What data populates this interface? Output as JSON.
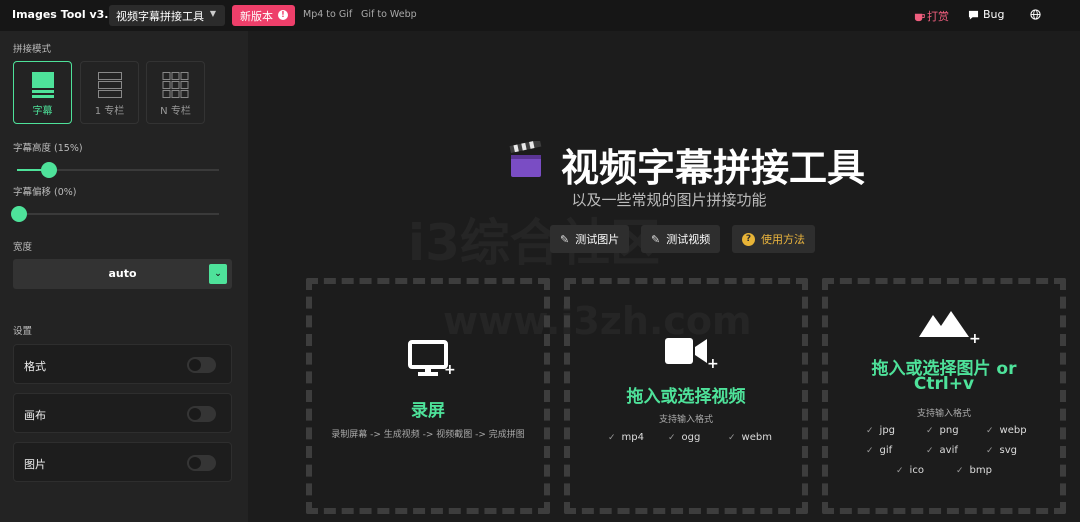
{
  "header": {
    "app_title": "Images Tool v3.0",
    "mode_select": "视频字幕拼接工具",
    "new_version": "新版本",
    "links": [
      "Mp4 to Gif",
      "Gif to Webp"
    ],
    "donate": "打赏",
    "bug": "Bug"
  },
  "sidebar": {
    "mode_label": "拼接模式",
    "modes": [
      {
        "label": "字幕",
        "active": true
      },
      {
        "label": "1 专栏",
        "active": false
      },
      {
        "label": "N 专栏",
        "active": false
      }
    ],
    "subtitle_height_label": "字幕高度 (15%)",
    "subtitle_height_value": 15,
    "subtitle_offset_label": "字幕偏移 (0%)",
    "subtitle_offset_value": 0,
    "width_label": "宽度",
    "width_value": "auto",
    "settings_label": "设置",
    "settings": [
      {
        "label": "格式",
        "on": false
      },
      {
        "label": "画布",
        "on": false
      },
      {
        "label": "图片",
        "on": false
      }
    ]
  },
  "main": {
    "title": "视频字幕拼接工具",
    "subtitle": "以及一些常规的图片拼接功能",
    "buttons": {
      "test_image": "测试图片",
      "test_video": "测试视频",
      "usage": "使用方法"
    },
    "watermark_big": "i3综合社区",
    "watermark_url": "www.i3zh.com",
    "panels": {
      "record": {
        "title": "录屏",
        "desc": "录制屏幕 -> 生成视频 -> 视频截图 -> 完成拼图"
      },
      "video": {
        "title": "拖入或选择视频",
        "formats_label": "支持输入格式",
        "formats": [
          "mp4",
          "ogg",
          "webm"
        ]
      },
      "image": {
        "title_line1": "拖入或选择图片 or",
        "title_line2": "Ctrl+v",
        "formats_label": "支持输入格式",
        "formats": [
          "jpg",
          "png",
          "webp",
          "gif",
          "avif",
          "svg",
          "ico",
          "bmp"
        ]
      }
    }
  },
  "colors": {
    "accent": "#4ee29a",
    "new_badge": "#ee3f6a",
    "donate": "#ef5e7e",
    "help": "#ebb53e"
  }
}
